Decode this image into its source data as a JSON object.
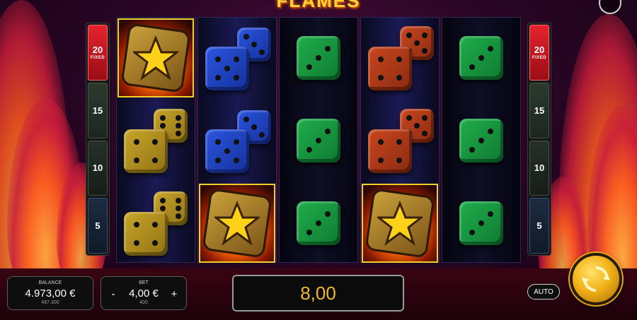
{
  "game": {
    "title_fragment": "FLAMES"
  },
  "ladders": {
    "left": [
      {
        "value": "20",
        "tag": "FIXED",
        "color": "#e5232e"
      },
      {
        "value": "15",
        "tag": ""
      },
      {
        "value": "10",
        "tag": ""
      },
      {
        "value": "5",
        "tag": ""
      }
    ],
    "right": [
      {
        "value": "20",
        "tag": "FIXED",
        "color": "#e5232e"
      },
      {
        "value": "15",
        "tag": ""
      },
      {
        "value": "10",
        "tag": ""
      },
      {
        "value": "5",
        "tag": ""
      }
    ]
  },
  "reels": [
    {
      "reel": 1,
      "symbols": [
        "star-scatter",
        "yellow-dice",
        "yellow-dice"
      ]
    },
    {
      "reel": 2,
      "symbols": [
        "blue-dice",
        "blue-dice",
        "star-scatter"
      ]
    },
    {
      "reel": 3,
      "symbols": [
        "green-dice",
        "green-dice",
        "green-dice"
      ]
    },
    {
      "reel": 4,
      "symbols": [
        "red-dice",
        "red-dice",
        "star-scatter"
      ]
    },
    {
      "reel": 5,
      "symbols": [
        "green-dice",
        "green-dice",
        "green-dice"
      ]
    }
  ],
  "balance": {
    "label": "BALANCE",
    "amount": "4.973,00 €",
    "credits": "497.300"
  },
  "bet": {
    "label": "BET",
    "minus": "-",
    "plus": "+",
    "amount": "4,00 €",
    "credits": "400"
  },
  "win": {
    "amount": "8,00"
  },
  "controls": {
    "auto_label": "AUTO",
    "spin_icon": "spin-arrows-icon",
    "info_icon": "info-icon"
  },
  "colors": {
    "win_text": "#f0b82a",
    "accent_gold": "#f3b21a",
    "highlight": "#f1d02a"
  }
}
